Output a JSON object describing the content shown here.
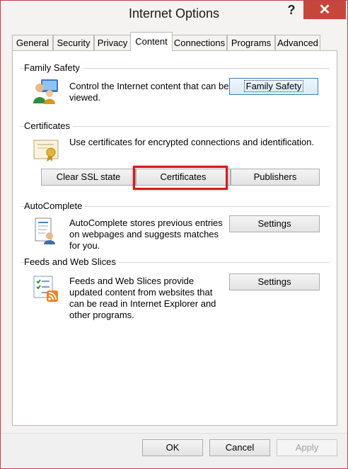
{
  "window": {
    "title": "Internet Options",
    "help_glyph": "?",
    "close_glyph": "✕"
  },
  "tabs": [
    {
      "label": "General",
      "active": false
    },
    {
      "label": "Security",
      "active": false
    },
    {
      "label": "Privacy",
      "active": false
    },
    {
      "label": "Content",
      "active": true
    },
    {
      "label": "Connections",
      "active": false
    },
    {
      "label": "Programs",
      "active": false
    },
    {
      "label": "Advanced",
      "active": false
    }
  ],
  "family_safety": {
    "heading": "Family Safety",
    "description": "Control the Internet content that can be viewed.",
    "button": "Family Safety",
    "icon": "family-safety-icon"
  },
  "certificates": {
    "heading": "Certificates",
    "description": "Use certificates for encrypted connections and identification.",
    "clear_ssl_button": "Clear SSL state",
    "certificates_button": "Certificates",
    "publishers_button": "Publishers",
    "icon": "certificate-icon",
    "highlight_color": "#d41c1c"
  },
  "autocomplete": {
    "heading": "AutoComplete",
    "description": "AutoComplete stores previous entries on webpages and suggests matches for you.",
    "settings_button": "Settings",
    "icon": "autocomplete-icon"
  },
  "feeds": {
    "heading": "Feeds and Web Slices",
    "description": "Feeds and Web Slices provide updated content from websites that can be read in Internet Explorer and other programs.",
    "settings_button": "Settings",
    "icon": "feeds-rss-icon"
  },
  "footer": {
    "ok": "OK",
    "cancel": "Cancel",
    "apply": "Apply"
  },
  "colors": {
    "close_button": "#c7463b",
    "window_border": "#c43d4c",
    "accent_focus": "#3c7fb1"
  }
}
